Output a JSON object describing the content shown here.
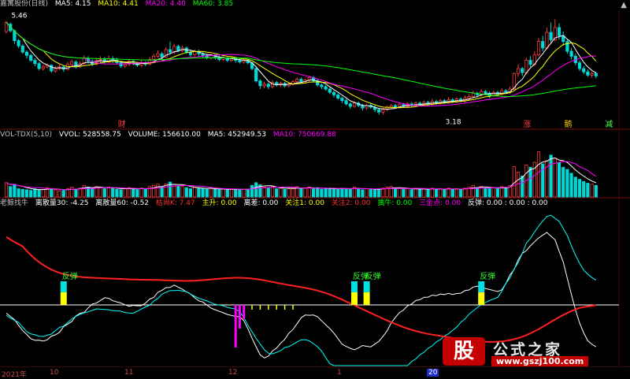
{
  "main_header": {
    "title": "嘉寓股份(日线)",
    "items": [
      {
        "label": "MA5: 4.15",
        "color": "#ffffff"
      },
      {
        "label": "MA10: 4.41",
        "color": "#ffff00"
      },
      {
        "label": "MA20: 4.40",
        "color": "#ff00ff"
      },
      {
        "label": "MA60: 3.85",
        "color": "#00ff00"
      }
    ]
  },
  "vol_header": {
    "items": [
      {
        "label": "VOL-TDX(5,10)",
        "color": "#c0c0c0"
      },
      {
        "label": "VVOL: 528558.75",
        "color": "#ffffff"
      },
      {
        "label": "VOLUME: 156610.00",
        "color": "#ffffff"
      },
      {
        "label": "MA5: 452949.53",
        "color": "#ffffff"
      },
      {
        "label": "MA10: 750669.88",
        "color": "#ff00ff"
      }
    ]
  },
  "ind_header": {
    "items": [
      {
        "label": "老鲸找牛",
        "color": "#c0c0c0"
      },
      {
        "label": "离散量30: -4.25",
        "color": "#ffffff"
      },
      {
        "label": "离散量60: -0.52",
        "color": "#ffffff"
      },
      {
        "label": "枯尚K: 7.47",
        "color": "#ff3030"
      },
      {
        "label": "主升: 0.00",
        "color": "#ffff00"
      },
      {
        "label": "离差: 0.00",
        "color": "#ffffff"
      },
      {
        "label": "关注1: 0.00",
        "color": "#ffff00"
      },
      {
        "label": "关注2: 0.00",
        "color": "#ff3030"
      },
      {
        "label": "擒牛: 0.00",
        "color": "#00ff00"
      },
      {
        "label": "三金点: 0.00",
        "color": "#ff00ff"
      },
      {
        "label": "反弹: 0.00 : 0.00 : 0.00",
        "color": "#ffffff"
      }
    ]
  },
  "date_axis": {
    "labels": [
      {
        "text": "2021年",
        "highlight": false
      },
      {
        "text": "10",
        "highlight": false
      },
      {
        "text": "11",
        "highlight": false
      },
      {
        "text": "12",
        "highlight": false
      },
      {
        "text": "1",
        "highlight": false
      },
      {
        "text": "20",
        "highlight": true
      }
    ]
  },
  "watermark": {
    "logo": "股",
    "title": "公式之家",
    "url": "www.gszj100.com"
  },
  "chart_data": [
    {
      "type": "candlestick",
      "name": "main",
      "ylim": [
        2.9,
        5.7
      ],
      "annotations": [
        {
          "text": "5.46",
          "x": 2,
          "y": 5.46
        },
        {
          "text": "3.18",
          "x": 108,
          "y": 3.18
        },
        {
          "text": "财",
          "x": 28
        },
        {
          "text": "涨",
          "x": 127
        },
        {
          "text": "鹅",
          "x": 137
        },
        {
          "text": "减",
          "x": 147
        }
      ],
      "candles": [
        [
          5.2,
          5.42,
          5.15,
          5.46
        ],
        [
          5.38,
          5.22,
          5.18,
          5.42
        ],
        [
          5.22,
          4.98,
          4.9,
          5.25
        ],
        [
          4.98,
          4.85,
          4.8,
          5.02
        ],
        [
          4.85,
          4.7,
          4.66,
          4.9
        ],
        [
          4.7,
          4.62,
          4.55,
          4.74
        ],
        [
          4.62,
          4.5,
          4.46,
          4.66
        ],
        [
          4.5,
          4.42,
          4.36,
          4.55
        ],
        [
          4.42,
          4.3,
          4.26,
          4.46
        ],
        [
          4.3,
          4.34,
          4.25,
          4.4
        ],
        [
          4.34,
          4.38,
          4.3,
          4.42
        ],
        [
          4.38,
          4.24,
          4.2,
          4.4
        ],
        [
          4.24,
          4.3,
          4.2,
          4.36
        ],
        [
          4.3,
          4.34,
          4.26,
          4.4
        ],
        [
          4.34,
          4.28,
          4.22,
          4.38
        ],
        [
          4.28,
          4.4,
          4.26,
          4.46
        ],
        [
          4.4,
          4.46,
          4.35,
          4.52
        ],
        [
          4.46,
          4.36,
          4.3,
          4.5
        ],
        [
          4.36,
          4.42,
          4.32,
          4.48
        ],
        [
          4.42,
          4.55,
          4.4,
          4.62
        ],
        [
          4.55,
          4.48,
          4.42,
          4.6
        ],
        [
          4.48,
          4.4,
          4.36,
          4.52
        ],
        [
          4.4,
          4.5,
          4.38,
          4.56
        ],
        [
          4.5,
          4.52,
          4.44,
          4.6
        ],
        [
          4.52,
          4.46,
          4.42,
          4.58
        ],
        [
          4.46,
          4.54,
          4.44,
          4.62
        ],
        [
          4.54,
          4.5,
          4.44,
          4.6
        ],
        [
          4.5,
          4.44,
          4.4,
          4.56
        ],
        [
          4.44,
          4.36,
          4.32,
          4.48
        ],
        [
          4.36,
          4.4,
          4.32,
          4.46
        ],
        [
          4.4,
          4.48,
          4.36,
          4.54
        ],
        [
          4.48,
          4.42,
          4.38,
          4.52
        ],
        [
          4.42,
          4.38,
          4.34,
          4.46
        ],
        [
          4.38,
          4.44,
          4.34,
          4.5
        ],
        [
          4.44,
          4.4,
          4.36,
          4.48
        ],
        [
          4.4,
          4.52,
          4.38,
          4.58
        ],
        [
          4.52,
          4.6,
          4.48,
          4.66
        ],
        [
          4.6,
          4.66,
          4.56,
          4.74
        ],
        [
          4.66,
          4.58,
          4.52,
          4.7
        ],
        [
          4.58,
          4.76,
          4.56,
          4.82
        ],
        [
          4.76,
          4.7,
          4.64,
          4.96
        ],
        [
          4.7,
          4.84,
          4.66,
          4.9
        ],
        [
          4.84,
          4.74,
          4.7,
          4.88
        ],
        [
          4.74,
          4.8,
          4.7,
          4.86
        ],
        [
          4.8,
          4.7,
          4.66,
          4.84
        ],
        [
          4.7,
          4.64,
          4.58,
          4.74
        ],
        [
          4.64,
          4.72,
          4.6,
          4.76
        ],
        [
          4.72,
          4.66,
          4.6,
          4.76
        ],
        [
          4.66,
          4.62,
          4.56,
          4.7
        ],
        [
          4.62,
          4.56,
          4.52,
          4.66
        ],
        [
          4.56,
          4.62,
          4.52,
          4.66
        ],
        [
          4.62,
          4.58,
          4.52,
          4.64
        ],
        [
          4.58,
          4.52,
          4.48,
          4.62
        ],
        [
          4.52,
          4.56,
          4.48,
          4.6
        ],
        [
          4.56,
          4.5,
          4.46,
          4.58
        ],
        [
          4.5,
          4.56,
          4.46,
          4.6
        ],
        [
          4.56,
          4.5,
          4.44,
          4.58
        ],
        [
          4.5,
          4.46,
          4.42,
          4.54
        ],
        [
          4.46,
          4.5,
          4.42,
          4.54
        ],
        [
          4.5,
          4.44,
          4.4,
          4.52
        ],
        [
          4.44,
          4.3,
          4.26,
          4.46
        ],
        [
          4.3,
          4.0,
          3.96,
          4.32
        ],
        [
          4.0,
          3.88,
          3.8,
          4.04
        ],
        [
          3.88,
          3.92,
          3.82,
          3.98
        ],
        [
          3.92,
          3.86,
          3.8,
          3.96
        ],
        [
          3.86,
          3.96,
          3.82,
          4.02
        ],
        [
          3.96,
          3.9,
          3.86,
          4.0
        ],
        [
          3.9,
          3.94,
          3.86,
          3.98
        ],
        [
          3.94,
          3.88,
          3.84,
          3.98
        ],
        [
          3.88,
          3.92,
          3.84,
          3.96
        ],
        [
          3.92,
          3.98,
          3.88,
          4.02
        ],
        [
          3.98,
          4.04,
          3.94,
          4.08
        ],
        [
          4.04,
          3.98,
          3.94,
          4.08
        ],
        [
          3.98,
          4.02,
          3.94,
          4.06
        ],
        [
          4.02,
          4.08,
          3.98,
          4.12
        ],
        [
          4.08,
          4.0,
          3.96,
          4.12
        ],
        [
          4.0,
          3.9,
          3.86,
          4.04
        ],
        [
          3.9,
          3.86,
          3.8,
          3.94
        ],
        [
          3.86,
          3.8,
          3.76,
          3.9
        ],
        [
          3.8,
          3.72,
          3.68,
          3.84
        ],
        [
          3.72,
          3.66,
          3.6,
          3.76
        ],
        [
          3.66,
          3.58,
          3.54,
          3.7
        ],
        [
          3.58,
          3.52,
          3.46,
          3.62
        ],
        [
          3.52,
          3.44,
          3.4,
          3.56
        ],
        [
          3.44,
          3.38,
          3.32,
          3.48
        ],
        [
          3.38,
          3.46,
          3.34,
          3.5
        ],
        [
          3.46,
          3.4,
          3.36,
          3.5
        ],
        [
          3.4,
          3.34,
          3.28,
          3.44
        ],
        [
          3.34,
          3.4,
          3.3,
          3.44
        ],
        [
          3.4,
          3.36,
          3.32,
          3.44
        ],
        [
          3.36,
          3.3,
          3.24,
          3.4
        ],
        [
          3.3,
          3.24,
          3.18,
          3.34
        ],
        [
          3.24,
          3.3,
          3.18,
          3.34
        ],
        [
          3.3,
          3.36,
          3.26,
          3.4
        ],
        [
          3.36,
          3.4,
          3.32,
          3.44
        ],
        [
          3.4,
          3.36,
          3.32,
          3.44
        ],
        [
          3.36,
          3.42,
          3.32,
          3.46
        ],
        [
          3.42,
          3.38,
          3.34,
          3.46
        ],
        [
          3.38,
          3.44,
          3.34,
          3.48
        ],
        [
          3.44,
          3.4,
          3.36,
          3.48
        ],
        [
          3.4,
          3.46,
          3.36,
          3.5
        ],
        [
          3.46,
          3.42,
          3.38,
          3.5
        ],
        [
          3.42,
          3.48,
          3.38,
          3.52
        ],
        [
          3.48,
          3.44,
          3.4,
          3.52
        ],
        [
          3.44,
          3.5,
          3.4,
          3.56
        ],
        [
          3.5,
          3.46,
          3.42,
          3.54
        ],
        [
          3.46,
          3.52,
          3.42,
          3.56
        ],
        [
          3.52,
          3.48,
          3.44,
          3.56
        ],
        [
          3.48,
          3.54,
          3.44,
          3.6
        ],
        [
          3.54,
          3.5,
          3.46,
          3.58
        ],
        [
          3.5,
          3.56,
          3.46,
          3.6
        ],
        [
          3.56,
          3.52,
          3.48,
          3.6
        ],
        [
          3.52,
          3.58,
          3.48,
          3.64
        ],
        [
          3.58,
          3.62,
          3.54,
          3.68
        ],
        [
          3.62,
          3.7,
          3.58,
          3.76
        ],
        [
          3.7,
          3.66,
          3.6,
          3.74
        ],
        [
          3.66,
          3.74,
          3.62,
          3.8
        ],
        [
          3.74,
          3.7,
          3.66,
          3.78
        ],
        [
          3.7,
          3.64,
          3.58,
          3.74
        ],
        [
          3.64,
          3.72,
          3.6,
          3.76
        ],
        [
          3.72,
          3.68,
          3.62,
          3.76
        ],
        [
          3.68,
          3.76,
          3.64,
          3.82
        ],
        [
          3.76,
          3.72,
          3.68,
          3.8
        ],
        [
          3.72,
          3.8,
          3.68,
          3.86
        ],
        [
          3.8,
          4.18,
          3.78,
          4.2
        ],
        [
          4.18,
          4.3,
          4.1,
          4.4
        ],
        [
          4.3,
          4.2,
          4.12,
          4.34
        ],
        [
          4.2,
          4.5,
          4.16,
          4.56
        ],
        [
          4.5,
          4.4,
          4.34,
          4.6
        ],
        [
          4.4,
          4.64,
          4.36,
          4.72
        ],
        [
          4.64,
          4.96,
          4.6,
          5.04
        ],
        [
          4.96,
          4.8,
          4.72,
          5.1
        ],
        [
          4.8,
          5.18,
          4.76,
          5.3
        ],
        [
          5.18,
          5.0,
          4.9,
          5.42
        ],
        [
          5.0,
          5.3,
          4.96,
          5.5
        ],
        [
          5.3,
          5.1,
          5.0,
          5.4
        ],
        [
          5.1,
          4.96,
          4.86,
          5.2
        ],
        [
          4.96,
          4.72,
          4.66,
          5.0
        ],
        [
          4.72,
          4.6,
          4.52,
          4.8
        ],
        [
          4.6,
          4.44,
          4.38,
          4.66
        ],
        [
          4.44,
          4.3,
          4.24,
          4.5
        ],
        [
          4.3,
          4.22,
          4.16,
          4.36
        ],
        [
          4.22,
          4.14,
          4.1,
          4.28
        ],
        [
          4.14,
          4.18,
          4.08,
          4.22
        ],
        [
          4.18,
          4.12,
          4.06,
          4.22
        ]
      ],
      "series": [
        {
          "name": "MA5",
          "color": "#ffffff"
        },
        {
          "name": "MA10",
          "color": "#ffff00"
        },
        {
          "name": "MA20",
          "color": "#ff00ff"
        },
        {
          "name": "MA60",
          "color": "#00ff00"
        }
      ]
    },
    {
      "type": "bar",
      "name": "volume",
      "ylim": [
        0,
        2000000
      ],
      "values": [
        520000,
        380000,
        460000,
        300000,
        280000,
        260000,
        240000,
        300000,
        260000,
        280000,
        340000,
        300000,
        260000,
        220000,
        240000,
        300000,
        360000,
        280000,
        320000,
        420000,
        360000,
        300000,
        380000,
        340000,
        300000,
        360000,
        320000,
        280000,
        260000,
        300000,
        340000,
        300000,
        260000,
        320000,
        280000,
        380000,
        420000,
        460000,
        360000,
        480000,
        540000,
        460000,
        400000,
        380000,
        340000,
        300000,
        360000,
        320000,
        300000,
        280000,
        320000,
        280000,
        260000,
        300000,
        260000,
        300000,
        280000,
        260000,
        280000,
        260000,
        420000,
        520000,
        440000,
        360000,
        320000,
        380000,
        300000,
        320000,
        280000,
        300000,
        340000,
        380000,
        300000,
        320000,
        360000,
        300000,
        340000,
        280000,
        300000,
        320000,
        300000,
        280000,
        320000,
        300000,
        280000,
        360000,
        300000,
        260000,
        300000,
        280000,
        260000,
        300000,
        320000,
        360000,
        380000,
        300000,
        320000,
        280000,
        300000,
        260000,
        320000,
        280000,
        300000,
        260000,
        320000,
        280000,
        300000,
        260000,
        320000,
        280000,
        300000,
        260000,
        320000,
        360000,
        420000,
        340000,
        380000,
        320000,
        300000,
        340000,
        300000,
        380000,
        340000,
        420000,
        1100000,
        900000,
        760000,
        1160000,
        1080000,
        1260000,
        1640000,
        1200000,
        1320000,
        1520000,
        1400000,
        1260000,
        1080000,
        1000000,
        860000,
        720000,
        640000,
        560000,
        500000,
        460000,
        420000
      ]
    },
    {
      "type": "line",
      "name": "indicator",
      "ylim": [
        -60,
        95
      ],
      "zero": 0,
      "signals": [
        {
          "text": "反弹",
          "x": 14
        },
        {
          "text": "反弹",
          "x": 85
        },
        {
          "text": "反弹",
          "x": 88
        },
        {
          "text": "反弹",
          "x": 116
        }
      ],
      "series": [
        {
          "name": "离散量30",
          "color": "#ffffff"
        },
        {
          "name": "离散量60",
          "color": "#00ffff"
        },
        {
          "name": "枯尚K",
          "color": "#ff2020"
        }
      ]
    }
  ]
}
